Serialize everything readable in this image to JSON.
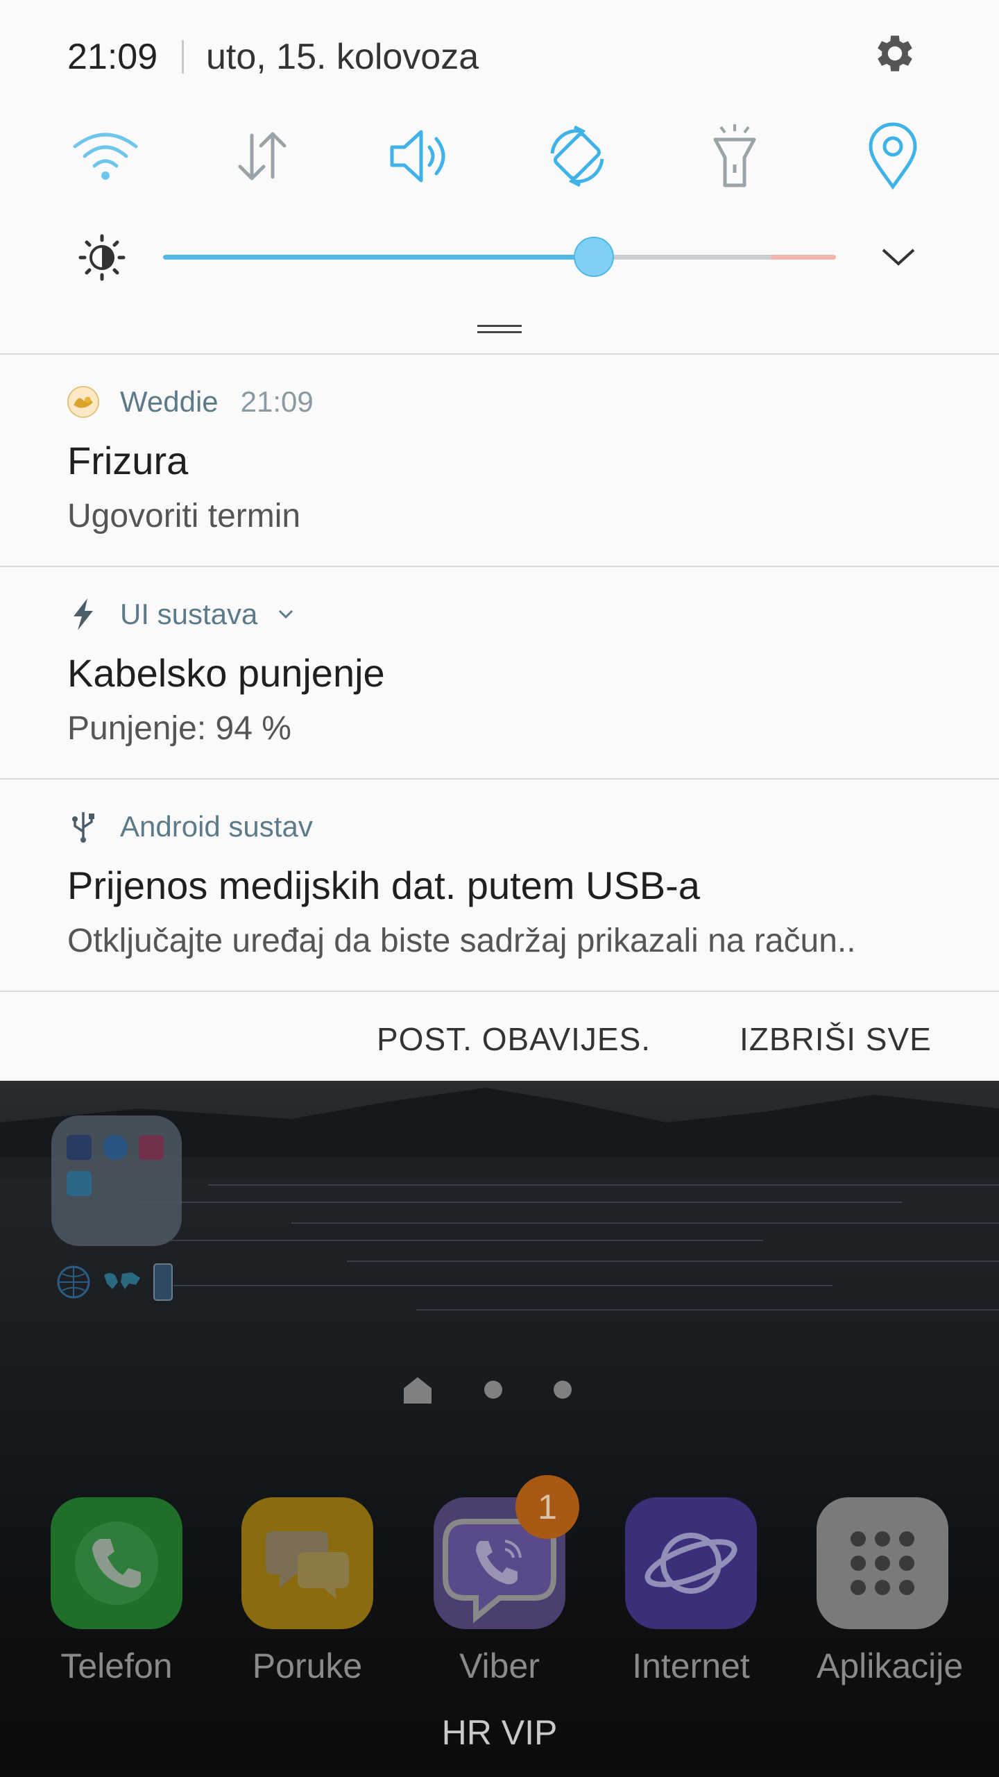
{
  "status": {
    "time": "21:09",
    "date": "uto, 15. kolovoza"
  },
  "quick_toggles": [
    {
      "name": "wifi",
      "active": true
    },
    {
      "name": "mobile-data",
      "active": false
    },
    {
      "name": "sound",
      "active": true
    },
    {
      "name": "auto-rotate",
      "active": true
    },
    {
      "name": "flashlight",
      "active": false
    },
    {
      "name": "location",
      "active": true
    }
  ],
  "brightness": {
    "level": 0.64
  },
  "notifications": [
    {
      "app": "Weddie",
      "time": "21:09",
      "title": "Frizura",
      "body": "Ugovoriti termin"
    },
    {
      "app": "UI sustava",
      "time": "",
      "title": "Kabelsko punjenje",
      "body": "Punjenje: 94 %"
    },
    {
      "app": "Android sustav",
      "time": "",
      "title": "Prijenos medijskih dat. putem USB-a",
      "body": "Otključajte uređaj da biste sadržaj prikazali na račun.."
    }
  ],
  "actions": {
    "settings_label": "POST. OBAVIJES.",
    "clear_label": "IZBRIŠI SVE"
  },
  "home": {
    "dock": [
      {
        "label": "Telefon",
        "color": "#1f6e2a"
      },
      {
        "label": "Poruke",
        "color": "#8a6b10"
      },
      {
        "label": "Viber",
        "color": "#4a3f6e",
        "badge": "1"
      },
      {
        "label": "Internet",
        "color": "#3b2f7a"
      },
      {
        "label": "Aplikacije",
        "color": "#7a7a7a"
      }
    ],
    "carrier": "HR VIP"
  },
  "colors": {
    "accent": "#4fb8e6",
    "inactive": "#9aa3a8",
    "panel_bg": "#fafafa"
  }
}
